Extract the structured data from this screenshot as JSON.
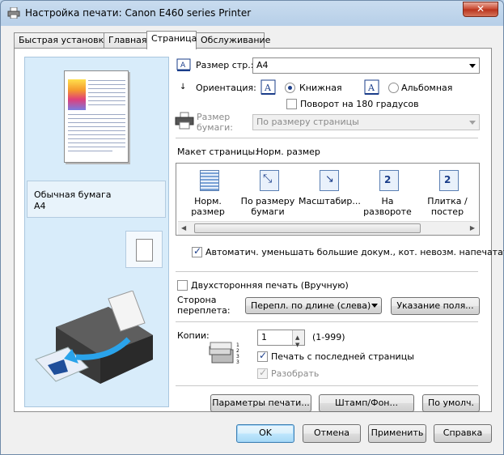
{
  "window": {
    "title": "Настройка печати: Canon E460 series Printer",
    "close": "✕"
  },
  "tabs": [
    "Быстрая установка",
    "Главная",
    "Страница",
    "Обслуживание"
  ],
  "preview": {
    "media_type": "Обычная бумага",
    "media_size": "A4"
  },
  "page_size": {
    "label": "Размер стр.:",
    "value": "A4"
  },
  "orientation": {
    "label": "Ориентация:",
    "portrait": "Книжная",
    "landscape": "Альбомная",
    "selected": "portrait",
    "rotate_label": "Поворот на 180 градусов",
    "rotate_checked": false
  },
  "paper_size": {
    "label_line1": "Размер",
    "label_line2": "бумаги:",
    "value": "По размеру страницы"
  },
  "page_layout": {
    "label": "Макет страницы:",
    "value": "Норм. размер",
    "items": [
      {
        "line1": "Норм.",
        "line2": "размер",
        "icon": "normal-size-icon",
        "selected": true
      },
      {
        "line1": "По размеру",
        "line2": "бумаги",
        "icon": "fit-to-paper-icon",
        "selected": false
      },
      {
        "line1": "Масштабир...",
        "line2": "",
        "icon": "scaled-icon",
        "selected": false
      },
      {
        "line1": "На развороте",
        "line2": "",
        "icon": "page-layout-icon",
        "selected": false
      },
      {
        "line1": "Плитка /",
        "line2": "постер",
        "icon": "tiling-poster-icon",
        "selected": false
      }
    ],
    "auto_reduce_label": "Автоматич. уменьшать большие докум., кот. невозм. напечатать",
    "auto_reduce_checked": true
  },
  "duplex": {
    "label": "Двухсторонняя печать (Вручную)",
    "checked": false,
    "binding_label_line1": "Сторона",
    "binding_label_line2": "переплета:",
    "binding_value": "Перепл. по длине (слева)",
    "margin_button": "Указание поля..."
  },
  "copies": {
    "label": "Копии:",
    "value": "1",
    "range": "(1-999)",
    "last_page_label": "Печать с последней страницы",
    "last_page_checked": true,
    "collate_label": "Разобрать",
    "collate_checked": true
  },
  "bottom_buttons": {
    "print_options": "Параметры печати...",
    "stamp": "Штамп/Фон...",
    "defaults": "По умолч."
  },
  "dialog_buttons": {
    "ok": "OK",
    "cancel": "Отмена",
    "apply": "Применить",
    "help": "Справка"
  }
}
